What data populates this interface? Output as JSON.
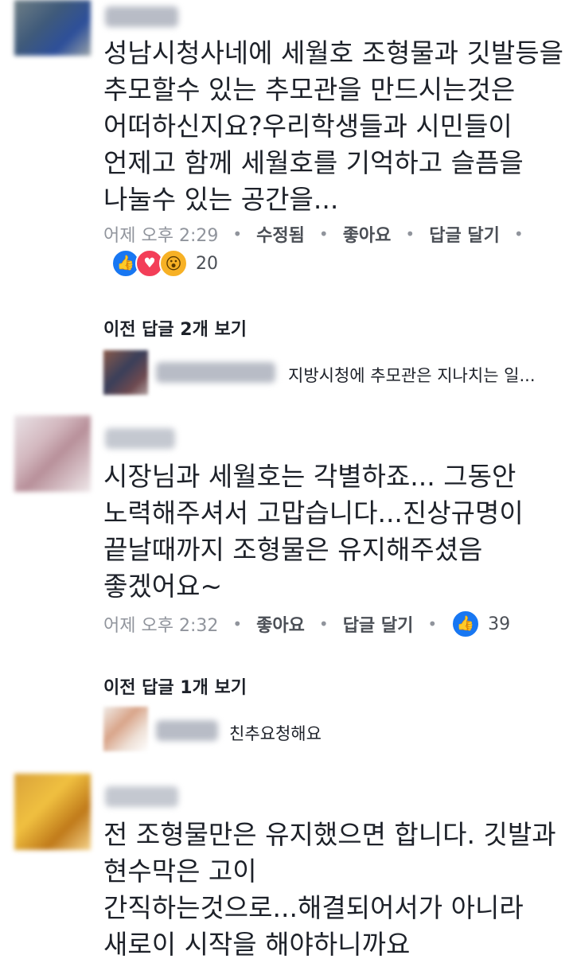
{
  "comments": [
    {
      "text": "성남시청사네에 세월호 조형물과 깃발등을\n추모할수 있는 추모관을 만드시는것은\n어떠하신지요?우리학생들과 시민들이\n언제고 함께 세월호를 기억하고 슬픔을\n나눌수 있는 공간을...",
      "time": "어제 오후 2:29",
      "edited": "수정됨",
      "like": "좋아요",
      "reply": "답글 달기",
      "reaction_count": "20",
      "view_prev": "이전 답글 2개 보기",
      "reply_preview": "지방시청에 추모관은 지나치는 일..."
    },
    {
      "text": "시장님과 세월호는 각별하죠... 그동안\n노력해주셔서 고맙습니다...진상규명이\n끝날때까지 조형물은 유지해주셨음\n좋겠어요~",
      "time": "어제 오후 2:32",
      "like": "좋아요",
      "reply": "답글 달기",
      "reaction_count": "39",
      "view_prev": "이전 답글 1개 보기",
      "reply_preview": "친추요청해요"
    },
    {
      "text": "전 조형물만은 유지했으면 합니다. 깃발과\n현수막은 고이\n간직하는것으로...해결되어서가 아니라\n새로이 시작을 해야하니까요"
    }
  ],
  "colors": {
    "like_blue": "#1877f2",
    "love_red": "#f33e58",
    "wow_yellow": "#f7b125",
    "meta_gray": "#90949c"
  }
}
